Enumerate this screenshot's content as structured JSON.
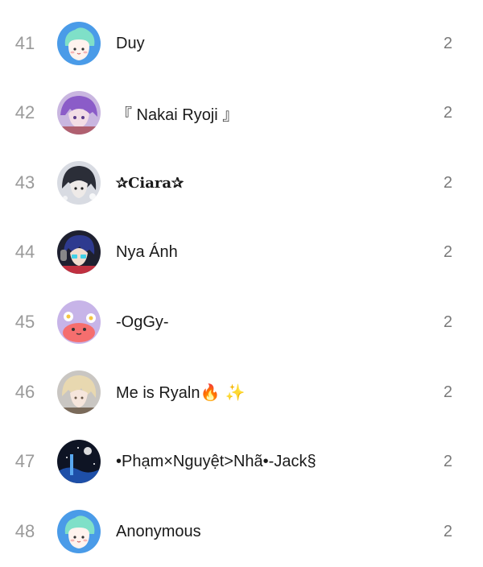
{
  "leaderboard": {
    "rows": [
      {
        "rank": "41",
        "name": "Duy",
        "count": "2",
        "avatar": "default-mascot-avatar"
      },
      {
        "rank": "42",
        "name": "『 Nakai Ryoji 』",
        "count": "2",
        "avatar": "purple-hair-anime-avatar"
      },
      {
        "rank": "43",
        "name": "✰Ciara✰",
        "count": "2",
        "avatar": "dark-hair-anime-avatar"
      },
      {
        "rank": "44",
        "name": "Nya Ánh",
        "count": "2",
        "avatar": "blue-hair-headphones-avatar"
      },
      {
        "rank": "45",
        "name": "-OgGy-",
        "count": "2",
        "avatar": "pink-crab-avatar"
      },
      {
        "rank": "46",
        "name": "Me is Ryaln",
        "name_emoji": "🔥 ✨",
        "count": "2",
        "avatar": "blonde-anime-avatar"
      },
      {
        "rank": "47",
        "name": "•Phạm×Nguyệt>Nhã•-Jack§",
        "count": "2",
        "avatar": "night-guitar-avatar"
      },
      {
        "rank": "48",
        "name": "Anonymous",
        "count": "2",
        "avatar": "default-mascot-avatar"
      }
    ]
  }
}
